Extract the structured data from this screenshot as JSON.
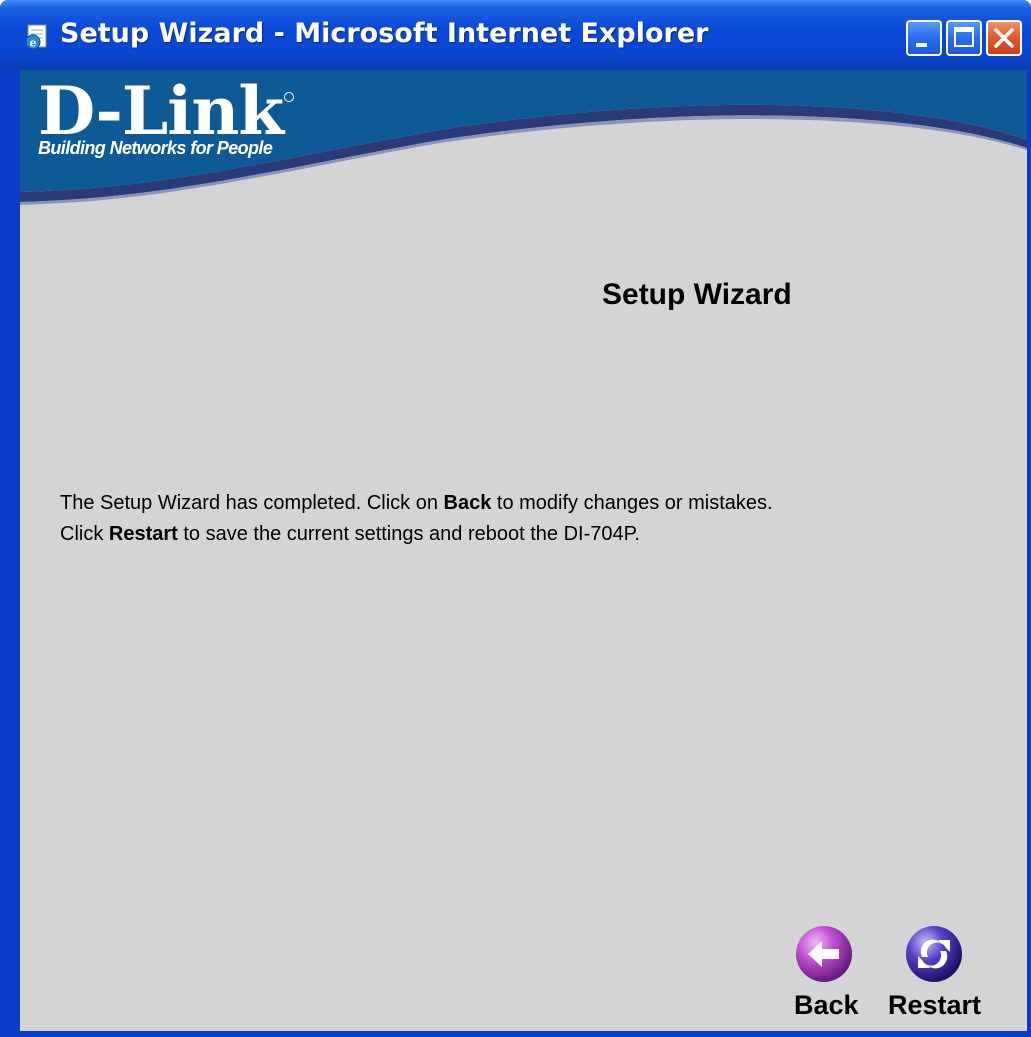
{
  "window": {
    "title": "Setup Wizard - Microsoft Internet Explorer",
    "controls": [
      "minimize",
      "maximize",
      "close"
    ]
  },
  "brand": {
    "logo": "D-Link",
    "tagline": "Building Networks for People",
    "colors": {
      "banner": "#0e5a96",
      "banner_stripe": "#2a3a78",
      "content_bg": "#d4d4d4"
    }
  },
  "page": {
    "title": "Setup Wizard",
    "message": {
      "line1_a": "The Setup Wizard has completed. Click on ",
      "line1_b": "Back",
      "line1_c": " to modify changes or mistakes.",
      "line2_a": "Click ",
      "line2_b": "Restart",
      "line2_c": " to save the current settings and reboot the DI-704P."
    }
  },
  "buttons": {
    "back": {
      "label": "Back",
      "icon": "left-arrow-icon",
      "color": "#b040c0"
    },
    "restart": {
      "label": "Restart",
      "icon": "restart-arrows-icon",
      "color": "#4830b0"
    }
  }
}
